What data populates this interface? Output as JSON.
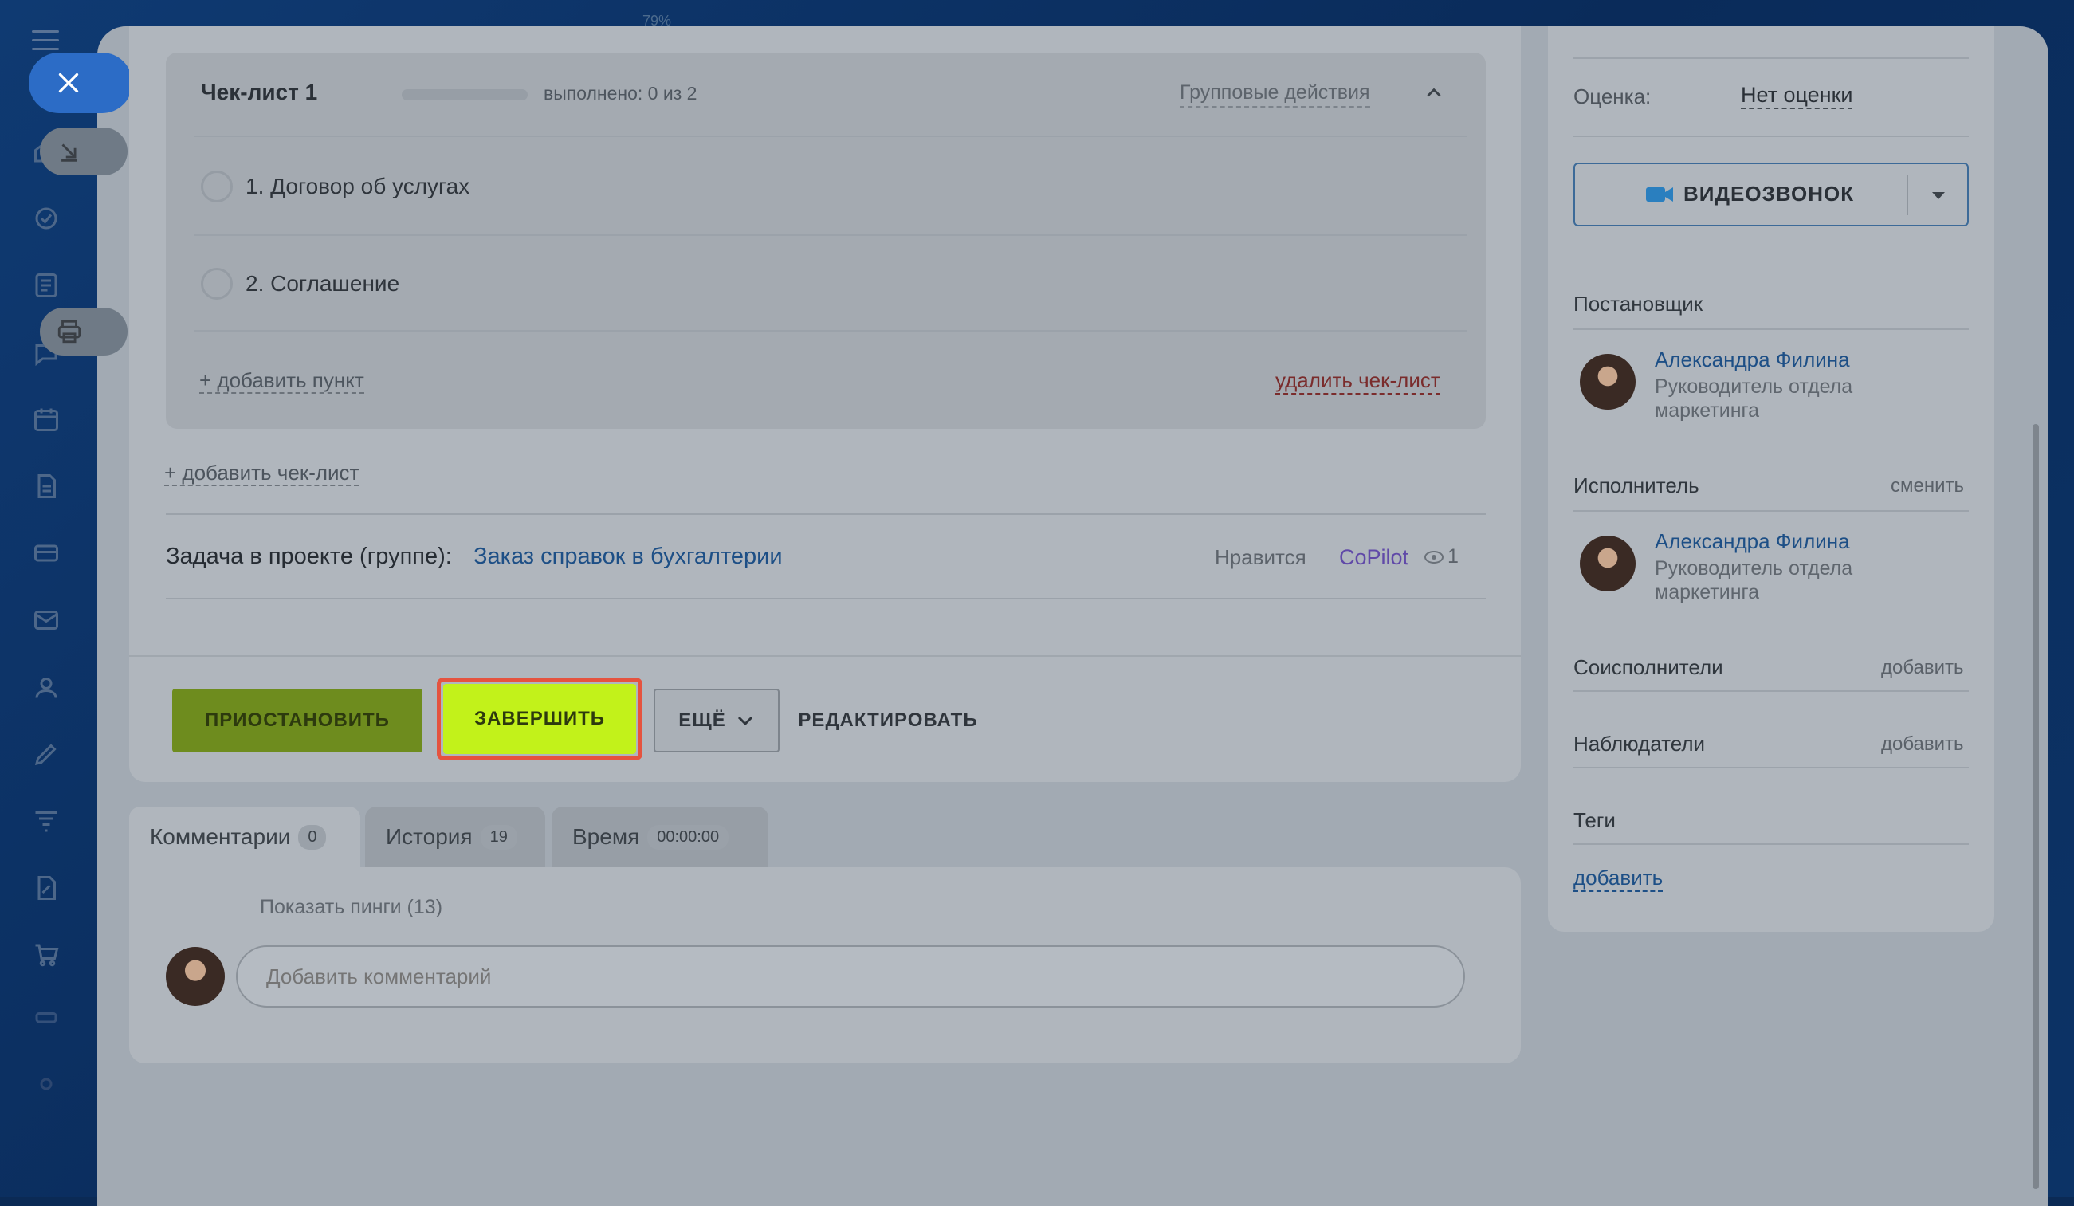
{
  "zoom_label": "79%",
  "checklist": {
    "title": "Чек-лист 1",
    "progress_text": "выполнено: 0 из 2",
    "progress_fraction": 0,
    "group_actions": "Групповые действия",
    "items": [
      {
        "label": "1. Договор об услугах"
      },
      {
        "label": "2. Соглашение"
      }
    ],
    "add_item": "+ добавить пункт",
    "delete_checklist": "удалить чек-лист",
    "add_checklist": "+ добавить чек-лист"
  },
  "project": {
    "label": "Задача в проекте (группе):",
    "link": "Заказ справок в бухгалтерии",
    "likes": "Нравится",
    "copilot": "CoPilot",
    "views": "1"
  },
  "actions": {
    "pause": "ПРИОСТАНОВИТЬ",
    "finish": "ЗАВЕРШИТЬ",
    "more": "ЕЩЁ",
    "edit": "РЕДАКТИРОВАТЬ"
  },
  "tabs": [
    {
      "label": "Комментарии",
      "count": "0"
    },
    {
      "label": "История",
      "count": "19"
    },
    {
      "label": "Время",
      "count": "00:00:00"
    }
  ],
  "comments": {
    "show_pings": "Показать пинги (13)",
    "placeholder": "Добавить комментарий"
  },
  "sidebar": {
    "rating_label": "Оценка:",
    "rating_value": "Нет оценки",
    "video_call": "ВИДЕОЗВОНОК",
    "creator_label": "Постановщик",
    "creator": {
      "name": "Александра Филина",
      "role": "Руководитель отдела маркетинга"
    },
    "assignee_label": "Исполнитель",
    "assignee_change": "сменить",
    "assignee": {
      "name": "Александра Филина",
      "role": "Руководитель отдела маркетинга"
    },
    "coassignees_label": "Соисполнители",
    "coassignees_add": "добавить",
    "observers_label": "Наблюдатели",
    "observers_add": "добавить",
    "tags_label": "Теги",
    "tags_add": "добавить"
  },
  "colors": {
    "finish_button": "#c2f21a",
    "pause_button": "#6e8c1e",
    "highlight_frame": "#e5533f",
    "link": "#1d4f86"
  }
}
